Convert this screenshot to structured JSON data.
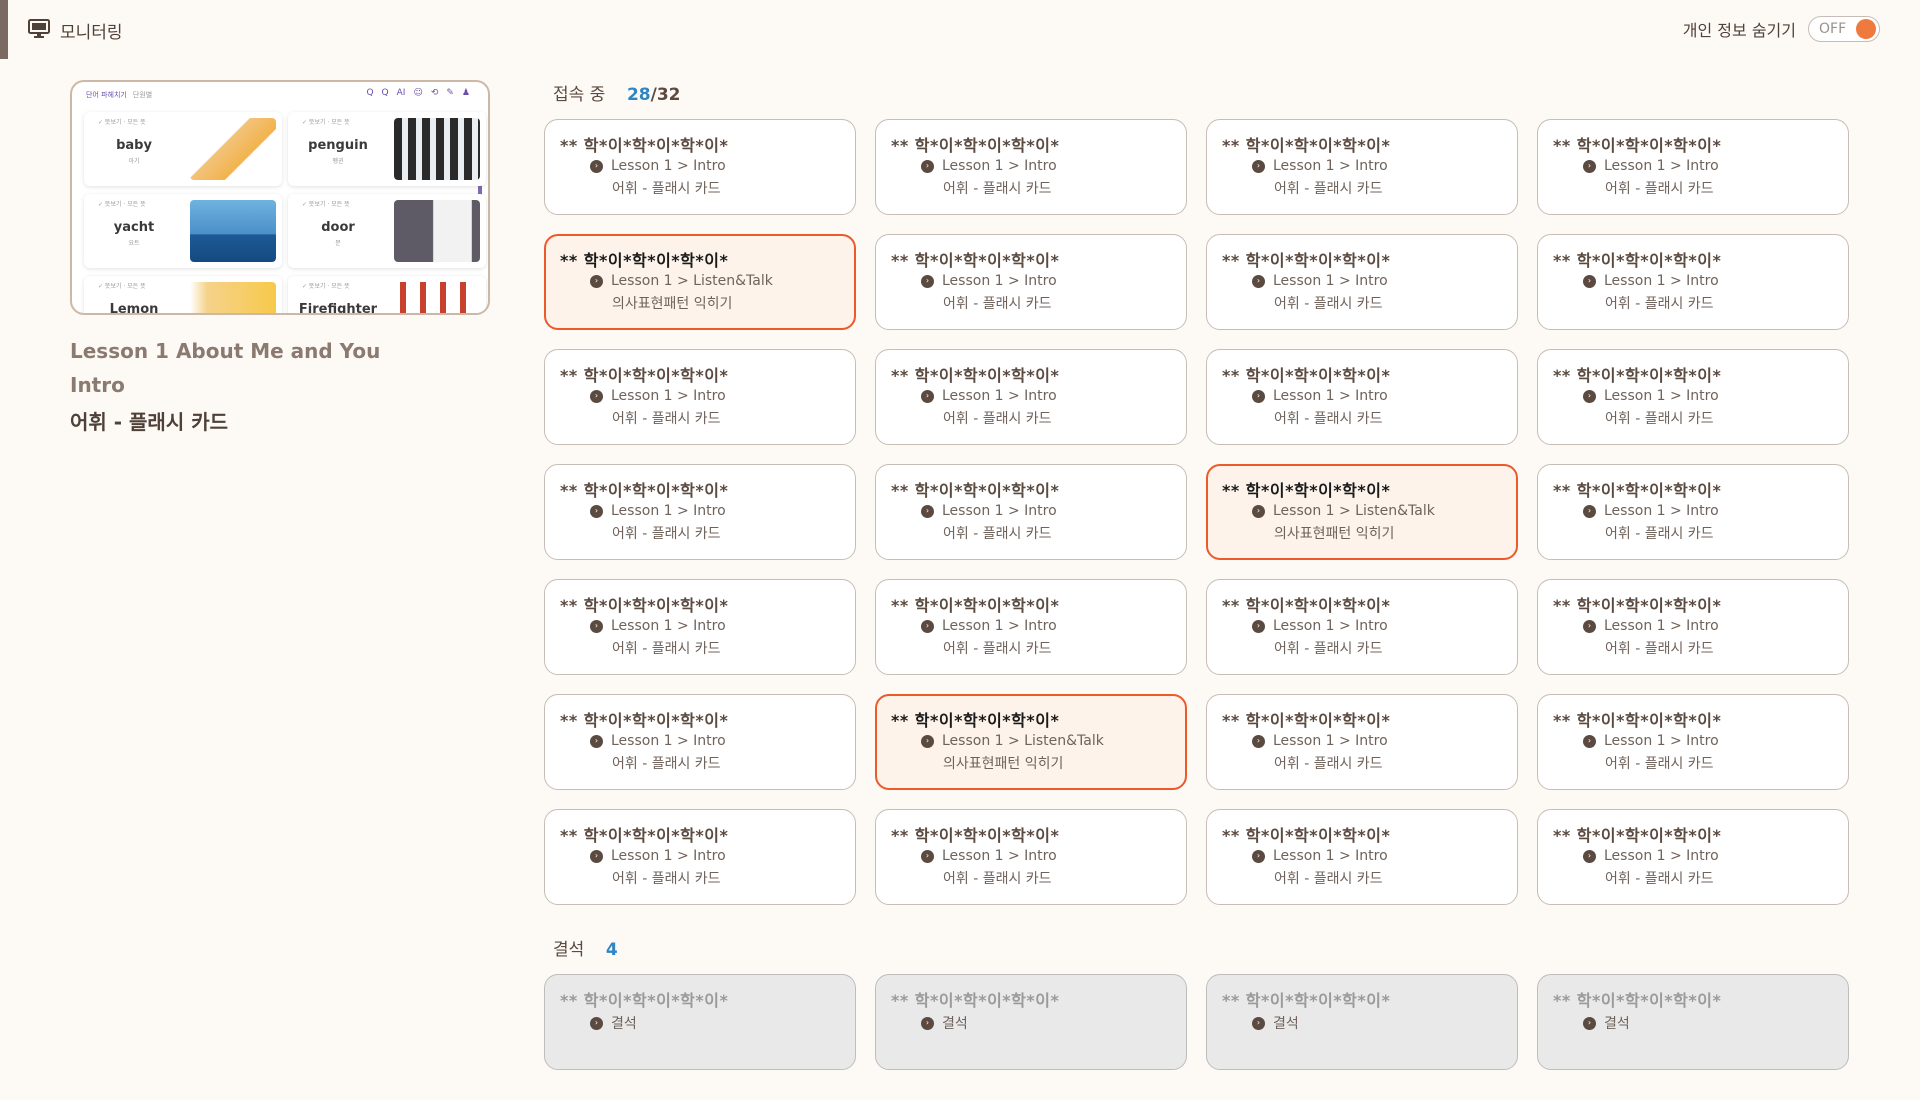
{
  "header": {
    "title": "모니터링",
    "privacy_label": "개인 정보 숨기기",
    "toggle_text": "OFF"
  },
  "preview": {
    "app_title": "단어 파헤치기",
    "app_sub": "단원별",
    "icon_labels": [
      "Q",
      "Q",
      "AI",
      "☺",
      "⟲",
      "✎",
      "♟"
    ],
    "cards": [
      {
        "word": "baby",
        "meta": "✓ 뜻보기 · 모든 뜻",
        "sub": "아기"
      },
      {
        "word": "penguin",
        "meta": "✓ 뜻보기 · 모든 뜻",
        "sub": "펭귄"
      },
      {
        "word": "yacht",
        "meta": "✓ 뜻보기 · 모든 뜻",
        "sub": "요트"
      },
      {
        "word": "door",
        "meta": "✓ 뜻보기 · 모든 뜻",
        "sub": "문"
      },
      {
        "word": "Lemon",
        "meta": "✓ 뜻보기 · 모든 뜻",
        "sub": ""
      },
      {
        "word": "Firefighter",
        "meta": "✓ 뜻보기 · 모든 뜻",
        "sub": ""
      }
    ]
  },
  "lesson": {
    "line1": "Lesson 1   About Me and You",
    "line2": "Intro",
    "line3": "어휘 - 플래시 카드"
  },
  "connected": {
    "label": "접속 중",
    "count": "28",
    "total": "/32",
    "students": [
      {
        "name": "**  학*이*학*이*학*이*",
        "line1": "Lesson 1 > Intro",
        "line2": "어휘 - 플래시 카드",
        "active": false
      },
      {
        "name": "**  학*이*학*이*학*이*",
        "line1": "Lesson 1 > Intro",
        "line2": "어휘 - 플래시 카드",
        "active": false
      },
      {
        "name": "**  학*이*학*이*학*이*",
        "line1": "Lesson 1 > Intro",
        "line2": "어휘 - 플래시 카드",
        "active": false
      },
      {
        "name": "**  학*이*학*이*학*이*",
        "line1": "Lesson 1 > Intro",
        "line2": "어휘 - 플래시 카드",
        "active": false
      },
      {
        "name": "**  학*이*학*이*학*이*",
        "line1": "Lesson 1 > Listen&Talk",
        "line2": "의사표현패턴 익히기",
        "active": true
      },
      {
        "name": "**  학*이*학*이*학*이*",
        "line1": "Lesson 1 > Intro",
        "line2": "어휘 - 플래시 카드",
        "active": false
      },
      {
        "name": "**  학*이*학*이*학*이*",
        "line1": "Lesson 1 > Intro",
        "line2": "어휘 - 플래시 카드",
        "active": false
      },
      {
        "name": "**  학*이*학*이*학*이*",
        "line1": "Lesson 1 > Intro",
        "line2": "어휘 - 플래시 카드",
        "active": false
      },
      {
        "name": "**  학*이*학*이*학*이*",
        "line1": "Lesson 1 > Intro",
        "line2": "어휘 - 플래시 카드",
        "active": false
      },
      {
        "name": "**  학*이*학*이*학*이*",
        "line1": "Lesson 1 > Intro",
        "line2": "어휘 - 플래시 카드",
        "active": false
      },
      {
        "name": "**  학*이*학*이*학*이*",
        "line1": "Lesson 1 > Intro",
        "line2": "어휘 - 플래시 카드",
        "active": false
      },
      {
        "name": "**  학*이*학*이*학*이*",
        "line1": "Lesson 1 > Intro",
        "line2": "어휘 - 플래시 카드",
        "active": false
      },
      {
        "name": "**  학*이*학*이*학*이*",
        "line1": "Lesson 1 > Intro",
        "line2": "어휘 - 플래시 카드",
        "active": false
      },
      {
        "name": "**  학*이*학*이*학*이*",
        "line1": "Lesson 1 > Intro",
        "line2": "어휘 - 플래시 카드",
        "active": false
      },
      {
        "name": "**  학*이*학*이*학*이*",
        "line1": "Lesson 1 > Listen&Talk",
        "line2": "의사표현패턴 익히기",
        "active": true
      },
      {
        "name": "**  학*이*학*이*학*이*",
        "line1": "Lesson 1 > Intro",
        "line2": "어휘 - 플래시 카드",
        "active": false
      },
      {
        "name": "**  학*이*학*이*학*이*",
        "line1": "Lesson 1 > Intro",
        "line2": "어휘 - 플래시 카드",
        "active": false
      },
      {
        "name": "**  학*이*학*이*학*이*",
        "line1": "Lesson 1 > Intro",
        "line2": "어휘 - 플래시 카드",
        "active": false
      },
      {
        "name": "**  학*이*학*이*학*이*",
        "line1": "Lesson 1 > Intro",
        "line2": "어휘 - 플래시 카드",
        "active": false
      },
      {
        "name": "**  학*이*학*이*학*이*",
        "line1": "Lesson 1 > Intro",
        "line2": "어휘 - 플래시 카드",
        "active": false
      },
      {
        "name": "**  학*이*학*이*학*이*",
        "line1": "Lesson 1 > Intro",
        "line2": "어휘 - 플래시 카드",
        "active": false
      },
      {
        "name": "**  학*이*학*이*학*이*",
        "line1": "Lesson 1 > Listen&Talk",
        "line2": "의사표현패턴 익히기",
        "active": true
      },
      {
        "name": "**  학*이*학*이*학*이*",
        "line1": "Lesson 1 > Intro",
        "line2": "어휘 - 플래시 카드",
        "active": false
      },
      {
        "name": "**  학*이*학*이*학*이*",
        "line1": "Lesson 1 > Intro",
        "line2": "어휘 - 플래시 카드",
        "active": false
      },
      {
        "name": "**  학*이*학*이*학*이*",
        "line1": "Lesson 1 > Intro",
        "line2": "어휘 - 플래시 카드",
        "active": false
      },
      {
        "name": "**  학*이*학*이*학*이*",
        "line1": "Lesson 1 > Intro",
        "line2": "어휘 - 플래시 카드",
        "active": false
      },
      {
        "name": "**  학*이*학*이*학*이*",
        "line1": "Lesson 1 > Intro",
        "line2": "어휘 - 플래시 카드",
        "active": false
      },
      {
        "name": "**  학*이*학*이*학*이*",
        "line1": "Lesson 1 > Intro",
        "line2": "어휘 - 플래시 카드",
        "active": false
      }
    ]
  },
  "absent": {
    "label": "결석",
    "count": "4",
    "students": [
      {
        "name": "**  학*이*학*이*학*이*",
        "status": "결석"
      },
      {
        "name": "**  학*이*학*이*학*이*",
        "status": "결석"
      },
      {
        "name": "**  학*이*학*이*학*이*",
        "status": "결석"
      },
      {
        "name": "**  학*이*학*이*학*이*",
        "status": "결석"
      }
    ]
  },
  "colors": {
    "background": "#fdfaf6",
    "active_border": "#ec5a2c",
    "count_blue": "#2f86c3",
    "toggle_knob": "#f07a3d"
  }
}
